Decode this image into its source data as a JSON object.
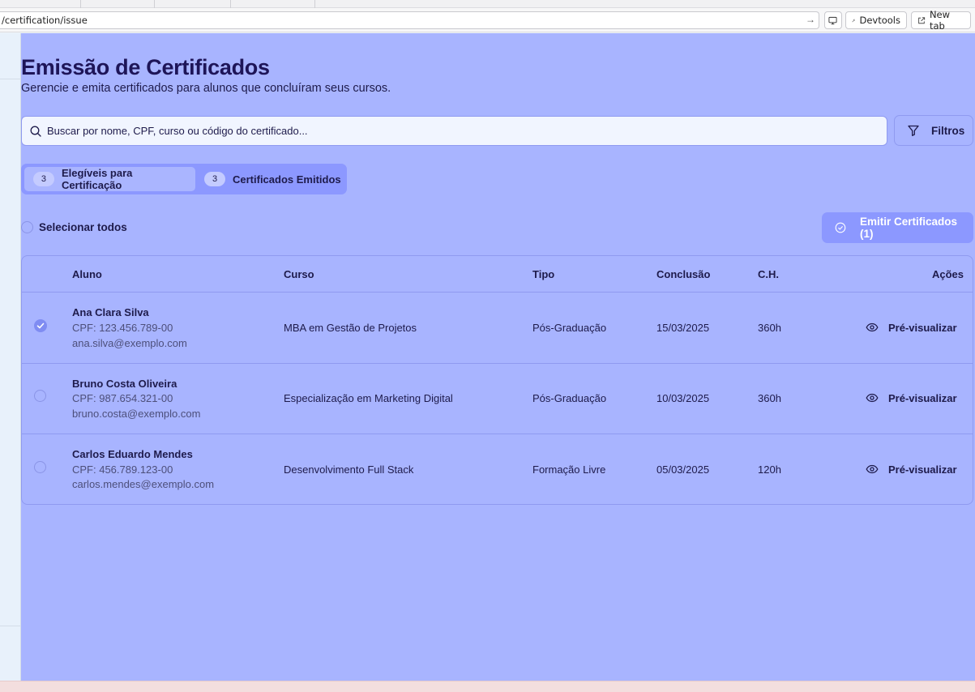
{
  "browser": {
    "url": "/certification/issue",
    "devtools_label": "Devtools",
    "newtab_label": "New tab"
  },
  "page": {
    "title": "Emissão de Certificados",
    "subtitle": "Gerencie e emita certificados para alunos que concluíram seus cursos."
  },
  "search": {
    "placeholder": "Buscar por nome, CPF, curso ou código do certificado..."
  },
  "filters_label": "Filtros",
  "tabs": [
    {
      "count": "3",
      "label": "Elegíveis para Certificação",
      "active": true
    },
    {
      "count": "3",
      "label": "Certificados Emitidos",
      "active": false
    }
  ],
  "select_all_label": "Selecionar todos",
  "emit_button_label": "Emitir Certificados (1)",
  "table": {
    "headers": {
      "aluno": "Aluno",
      "curso": "Curso",
      "tipo": "Tipo",
      "conclusao": "Conclusão",
      "ch": "C.H.",
      "acoes": "Ações"
    },
    "rows": [
      {
        "selected": true,
        "name": "Ana Clara Silva",
        "cpf": "CPF: 123.456.789-00",
        "email": "ana.silva@exemplo.com",
        "course": "MBA em Gestão de Projetos",
        "type": "Pós-Graduação",
        "date": "15/03/2025",
        "hours": "360h",
        "action": "Pré-visualizar"
      },
      {
        "selected": false,
        "name": "Bruno Costa Oliveira",
        "cpf": "CPF: 987.654.321-00",
        "email": "bruno.costa@exemplo.com",
        "course": "Especialização em Marketing Digital",
        "type": "Pós-Graduação",
        "date": "10/03/2025",
        "hours": "360h",
        "action": "Pré-visualizar"
      },
      {
        "selected": false,
        "name": "Carlos Eduardo Mendes",
        "cpf": "CPF: 456.789.123-00",
        "email": "carlos.mendes@exemplo.com",
        "course": "Desenvolvimento Full Stack",
        "type": "Formação Livre",
        "date": "05/03/2025",
        "hours": "120h",
        "action": "Pré-visualizar"
      }
    ]
  },
  "colors": {
    "page_background": "#a8b4ff",
    "accent": "#8c98ff",
    "text": "#1e1b4b"
  }
}
